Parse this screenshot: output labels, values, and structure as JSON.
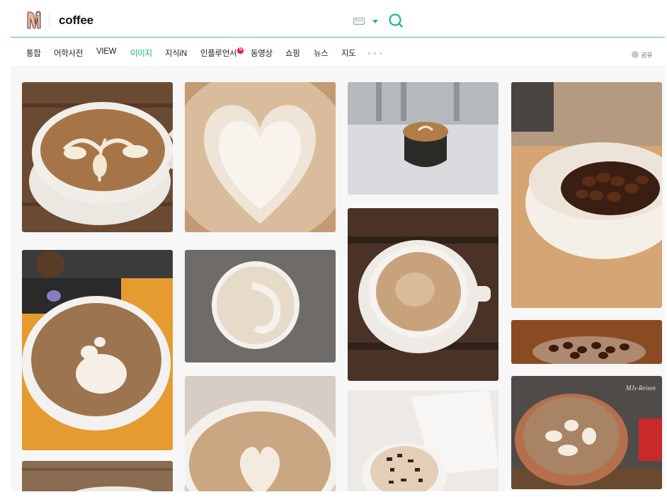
{
  "header": {
    "query": "coffee",
    "logo_letter": "N",
    "logo_icon": "naver-n-icon",
    "keyboard_icon": "keyboard-icon",
    "dropdown_icon": "caret-down-icon",
    "search_icon": "search-icon"
  },
  "tabs": [
    {
      "label": "통합"
    },
    {
      "label": "어학사전"
    },
    {
      "label": "VIEW"
    },
    {
      "label": "이미지",
      "active": true
    },
    {
      "label": "지식iN"
    },
    {
      "label": "인플루언서",
      "badge": "N"
    },
    {
      "label": "동영상"
    },
    {
      "label": "쇼핑"
    },
    {
      "label": "뉴스"
    },
    {
      "label": "지도"
    }
  ],
  "more_icon": "more-dots-icon",
  "share": {
    "label": "공유",
    "icon": "share-icon"
  },
  "results": [
    {
      "subject": "latte-art-cup-wood-table"
    },
    {
      "subject": "heart-latte-art-closeup"
    },
    {
      "subject": "latte-black-cup-cafe"
    },
    {
      "subject": "coffee-beans-white-bowl"
    },
    {
      "subject": "latte-cup-orange-table"
    },
    {
      "subject": "cappuccino-gray-felt"
    },
    {
      "subject": "cappuccino-saucer-wood"
    },
    {
      "subject": "coffee-beans-glass-jar"
    },
    {
      "subject": "latte-white-cup-heart"
    },
    {
      "subject": "mocha-chocolate-sprinkles"
    },
    {
      "subject": "latte-art-red-cup",
      "watermark": "MJs-Reisen"
    },
    {
      "subject": "coffee-cup-wooden-edge"
    }
  ],
  "colors": {
    "accent": "#03c75a",
    "header_line": "#4ec48b",
    "search_teal": "#19b7a0"
  }
}
